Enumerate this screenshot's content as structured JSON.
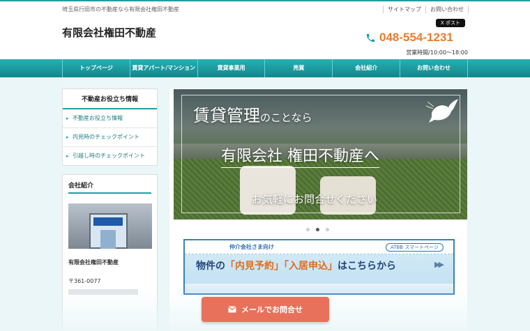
{
  "header": {
    "tagline": "埼玉県行田市の不動産なら有限会社権田不動産",
    "site_name": "有限会社権田不動産",
    "top_links": [
      "サイトマップ",
      "お問い合わせ"
    ],
    "x_post_label": "X ポスト",
    "phone": "048-554-1231",
    "hours": "営業時間/10:00〜18:00"
  },
  "nav": {
    "items": [
      "トップページ",
      "賃貸アパート/マンション",
      "賃貸事業用",
      "売買",
      "会社紹介",
      "お問い合わせ"
    ]
  },
  "sidebar": {
    "info_title": "不動産お役立ち情報",
    "info_items": [
      "不動産お役立ち情報",
      "内見時のチェックポイント",
      "引越し時のチェックポイント"
    ],
    "company_title": "会社紹介",
    "company_name": "有限会社権田不動産",
    "postal": "〒361-0077"
  },
  "slider": {
    "headline_big": "賃貸管理",
    "headline_small": "のことなら",
    "company": "有限会社 権田不動産へ",
    "contact": "お気軽にお問合せください",
    "active_slide": 2,
    "slide_count": 3
  },
  "banner": {
    "label": "仲介会社さま向け",
    "tag": "ATBB スマートページ",
    "text_pre": "物件の",
    "highlight1": "「内見予約」",
    "highlight2": "「入居申込」",
    "text_post": "はこちらから"
  },
  "mail_button": {
    "label": "メールでお問合せ"
  },
  "colors": {
    "accent": "#1d9ea3",
    "phone": "#ee7b2b",
    "mail_button": "#e8715c"
  }
}
